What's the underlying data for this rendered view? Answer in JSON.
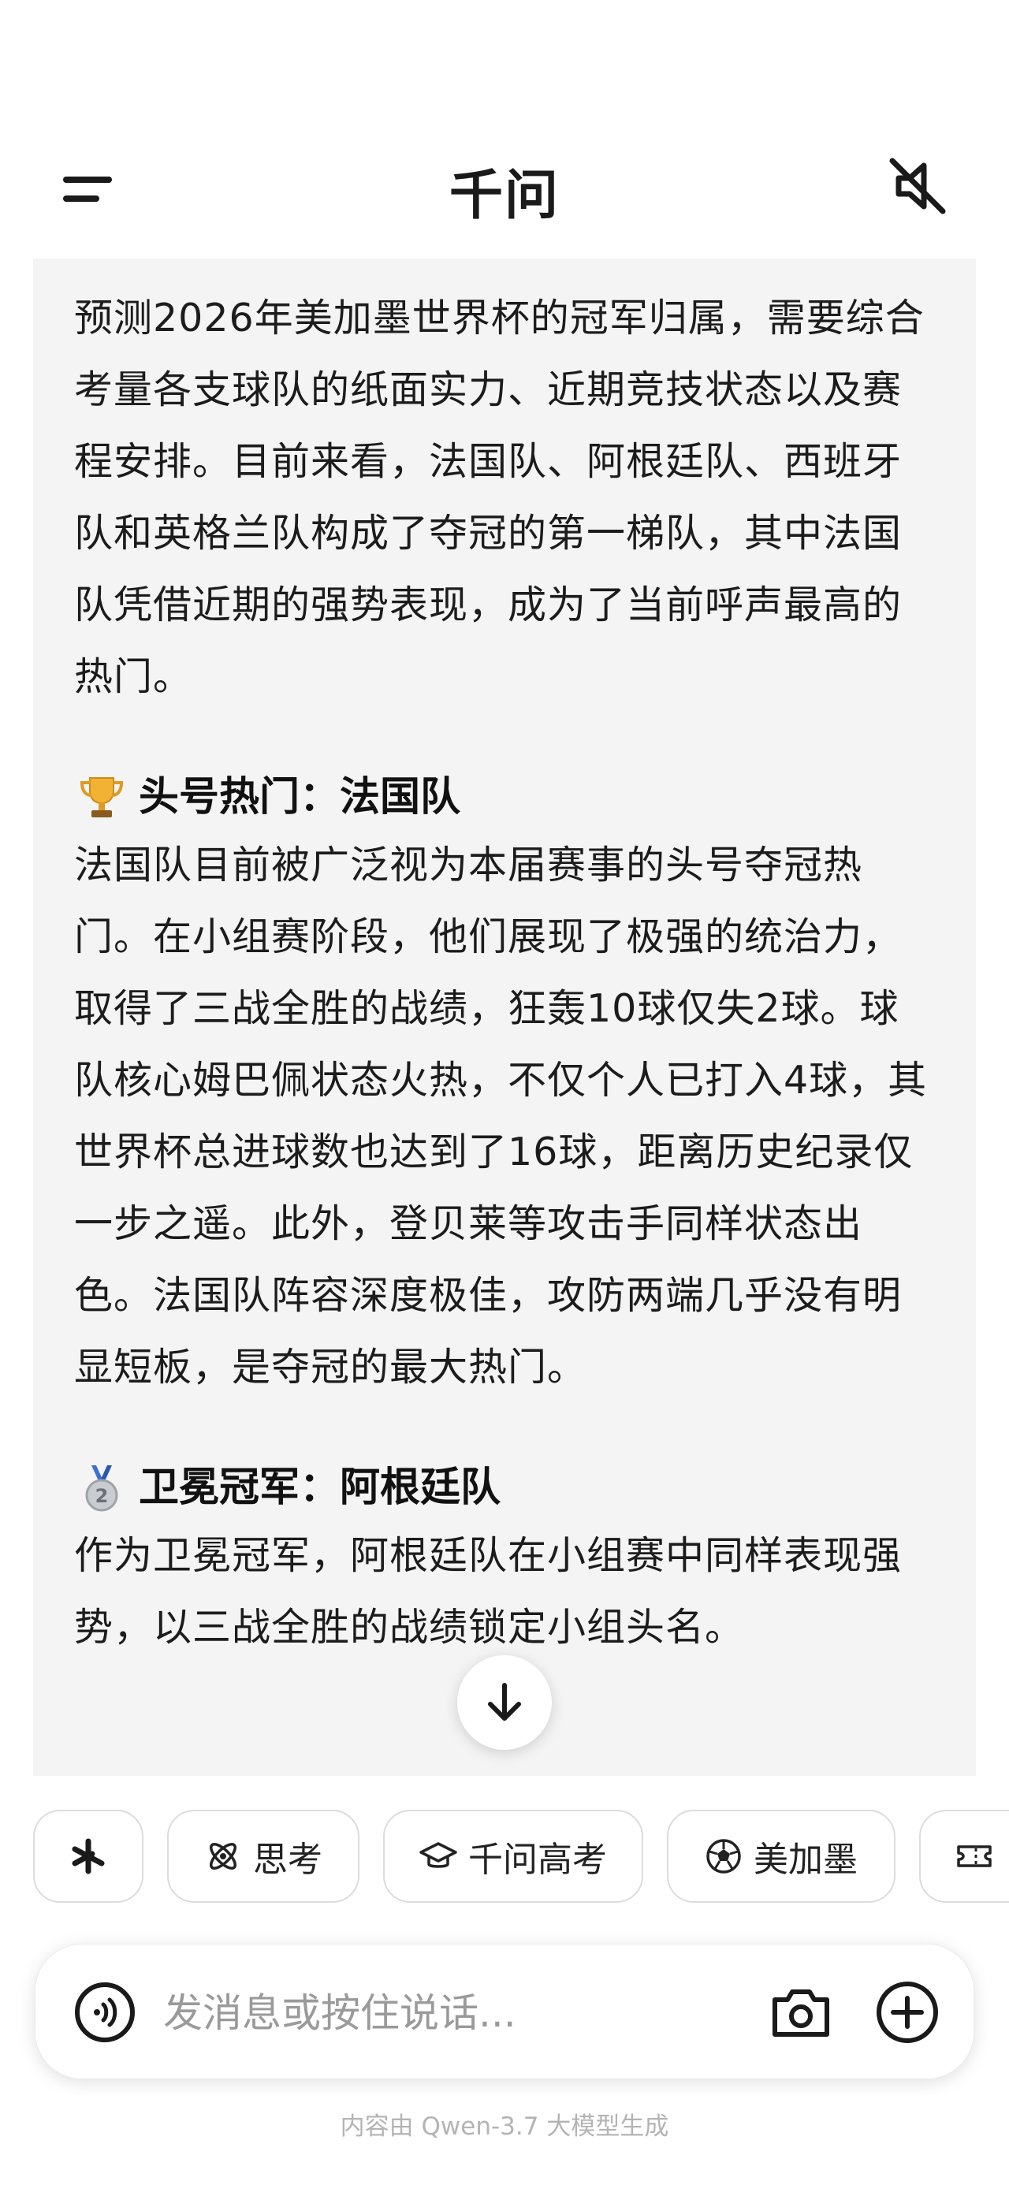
{
  "header": {
    "title": "千问",
    "menu_icon": "menu-icon",
    "mute_icon": "speaker-muted-icon"
  },
  "content": {
    "intro": "预测2026年美加墨世界杯的冠军归属，需要综合考量各支球队的纸面实力、近期竞技状态以及赛程安排。目前来看，法国队、阿根廷队、西班牙队和英格兰队构成了夺冠的第一梯队，其中法国队凭借近期的强势表现，成为了当前呼声最高的热门。",
    "sections": [
      {
        "emoji": "trophy-icon",
        "heading": "头号热门：法国队",
        "body": "法国队目前被广泛视为本届赛事的头号夺冠热门。在小组赛阶段，他们展现了极强的统治力，取得了三战全胜的战绩，狂轰10球仅失2球。球队核心姆巴佩状态火热，不仅个人已打入4球，其世界杯总进球数也达到了16球，距离历史纪录仅一步之遥。此外，登贝莱等攻击手同样状态出色。法国队阵容深度极佳，攻防两端几乎没有明显短板，是夺冠的最大热门。"
      },
      {
        "emoji": "second-place-medal-icon",
        "heading": "卫冕冠军：阿根廷队",
        "body": "作为卫冕冠军，阿根廷队在小组赛中同样表现强势，以三战全胜的战绩锁定小组头名。"
      }
    ]
  },
  "chips": [
    {
      "label": "",
      "icon": "asterisk-spark-icon"
    },
    {
      "label": "思考",
      "icon": "atom-icon"
    },
    {
      "label": "千问高考",
      "icon": "graduation-cap-icon"
    },
    {
      "label": "美加墨",
      "icon": "soccer-ball-icon"
    },
    {
      "label": "",
      "icon": "ticket-icon"
    }
  ],
  "input": {
    "placeholder": "发消息或按住说话...",
    "voice_icon": "voice-wave-icon",
    "camera_icon": "camera-icon",
    "plus_icon": "plus-circle-icon"
  },
  "footer": {
    "note": "内容由 Qwen-3.7 大模型生成"
  },
  "colors": {
    "content_background": "#f4f4f4",
    "text": "#1c1c1c",
    "placeholder": "#9a9a9a",
    "footer": "#b4b4b4"
  }
}
